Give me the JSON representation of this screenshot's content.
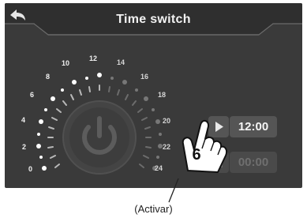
{
  "header": {
    "title": "Time switch"
  },
  "dial": {
    "labels": [
      "0",
      "2",
      "4",
      "6",
      "8",
      "10",
      "12",
      "14",
      "16",
      "18",
      "20",
      "22",
      "24"
    ]
  },
  "controls": {
    "start_time": "12:00",
    "end_time": "00:00"
  },
  "callout": {
    "step": "6"
  },
  "caption": "(Activar)"
}
